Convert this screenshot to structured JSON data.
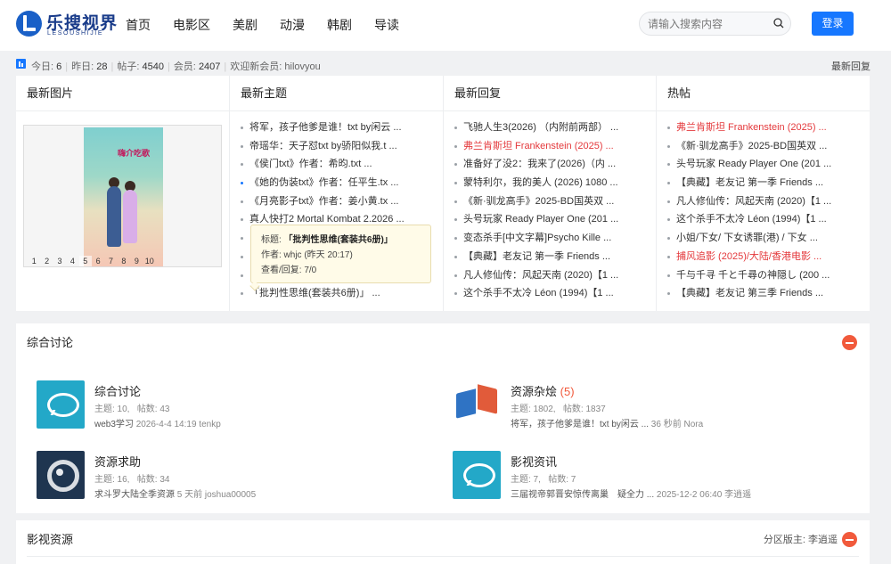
{
  "site": {
    "logo_text": "乐搜视界",
    "logo_sub": "LESOUSHIJIE"
  },
  "nav": [
    "首页",
    "电影区",
    "美剧",
    "动漫",
    "韩剧",
    "导读"
  ],
  "search": {
    "placeholder": "请输入搜索内容"
  },
  "login_label": "登录",
  "stats": {
    "today_label": "今日:",
    "today": "6",
    "yesterday_label": "昨日:",
    "yesterday": "28",
    "posts_label": "帖子:",
    "posts": "4540",
    "members_label": "会员:",
    "members": "2407",
    "welcome": "欢迎新会员: hilovyou",
    "right": "最新回复"
  },
  "columns": {
    "images": {
      "title": "最新图片",
      "poster_title": "嗨介吃歌",
      "pager": [
        "1",
        "2",
        "3",
        "4",
        "5",
        "6",
        "7",
        "8",
        "9",
        "10"
      ],
      "pager_active": "5"
    },
    "topics": {
      "title": "最新主题",
      "items": [
        "将军，孩子他爹是谁！txt by闲云 ...",
        "帝瑶华：天子怼txt by骄阳似我.t ...",
        "《侯门txt》作者：希昀.txt ...",
        "《她的伪装txt》作者：任平生.tx ...",
        "《月亮影子txt》作者：姜小黄.tx ...",
        "真人快打2 Mortal Kombat 2.2026 ...",
        "",
        "",
        "",
        "「批判性思维(套装共6册)」 ..."
      ]
    },
    "replies": {
      "title": "最新回复",
      "items": [
        "飞驰人生3(2026) （内附前两部） ...",
        "弗兰肯斯坦 Frankenstein (2025) ...",
        "准备好了没2：我来了(2026)（内 ...",
        "蒙特利尔，我的美人 (2026) 1080 ...",
        "《新·驯龙高手》2025-BD国英双 ...",
        "头号玩家 Ready Player One (201 ...",
        "变态杀手[中文字幕]Psycho Kille ...",
        "【典藏】老友记 第一季 Friends ...",
        "凡人修仙传：风起天南 (2020)【1 ...",
        "这个杀手不太冷 Léon (1994)【1 ..."
      ]
    },
    "hot": {
      "title": "热帖",
      "items": [
        "弗兰肯斯坦 Frankenstein (2025) ...",
        "《新·驯龙高手》2025-BD国英双 ...",
        "头号玩家 Ready Player One (201 ...",
        "【典藏】老友记 第一季 Friends ...",
        "凡人修仙传：风起天南 (2020)【1 ...",
        "这个杀手不太冷 Léon (1994)【1 ...",
        "小姐/下女/ 下女诱罪(港) / 下女 ...",
        "捕风追影 (2025)/大陆/香港电影 ...",
        "千与千寻 千と千尋の神隠し (200 ...",
        "【典藏】老友记 第三季 Friends ..."
      ]
    }
  },
  "tooltip": {
    "title_label": "标题:",
    "title": "「批判性思维(套装共6册)」",
    "author": "作者: whjc (昨天 20:17)",
    "views": "查看/回复: 7/0"
  },
  "discussion": {
    "title": "综合讨论",
    "forums": [
      {
        "name": "综合讨论",
        "count": "",
        "topics": "主题: 10,",
        "posts": "帖数: 43",
        "last": "web3学习",
        "last_meta": "2026-4-4 14:19 tenkp"
      },
      {
        "name": "资源杂烩",
        "count": "(5)",
        "topics": "主题: 1802,",
        "posts": "帖数: 1837",
        "last": "将军，孩子他爹是谁！txt by闲云 ...",
        "last_meta": "36 秒前 Nora"
      },
      {
        "name": "资源求助",
        "count": "",
        "topics": "主题: 16,",
        "posts": "帖数: 34",
        "last": "求斗罗大陆全季资源",
        "last_meta": "5 天前 joshua00005"
      },
      {
        "name": "影视资讯",
        "count": "",
        "topics": "主题: 7,",
        "posts": "帖数: 7",
        "last": "三届视帝郭晋安惊传离巢　疑全力 ...",
        "last_meta": "2025-12-2 06:40 李逍遥"
      }
    ]
  },
  "resources": {
    "title": "影视资源",
    "moderator": "分区版主: 李逍遥"
  },
  "colors": {
    "accent": "#1677ff",
    "hot": "#e4393c",
    "collapse": "#f15a3c"
  }
}
